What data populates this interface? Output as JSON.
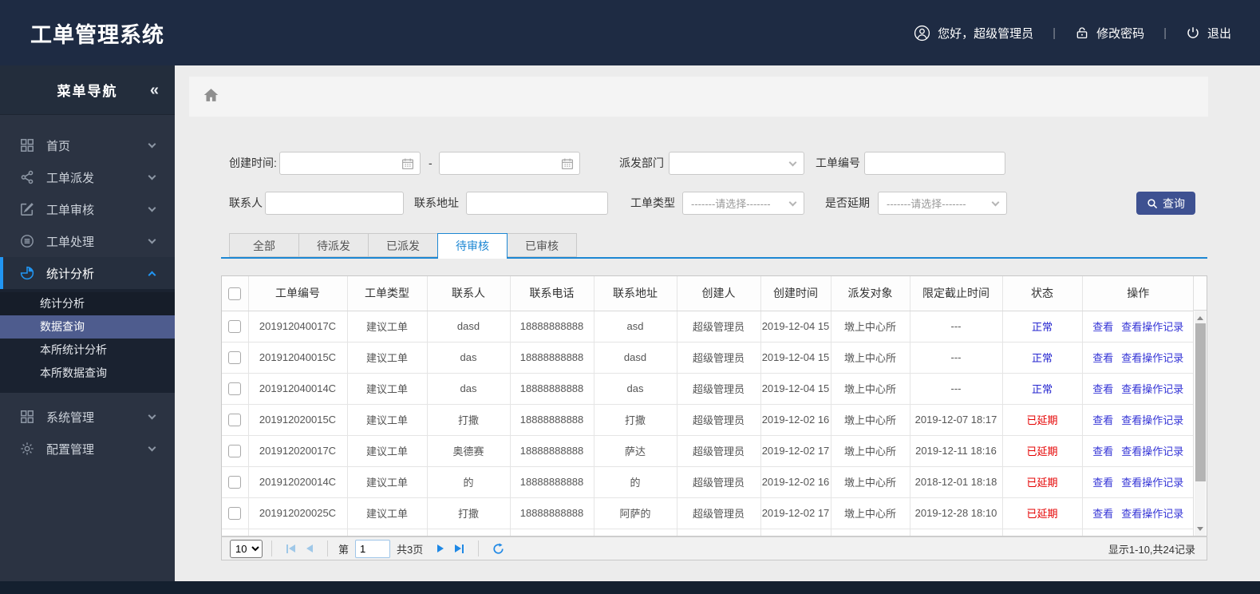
{
  "header": {
    "title": "工单管理系统",
    "greeting": "您好，超级管理员",
    "change_password": "修改密码",
    "logout": "退出",
    "separator": "|"
  },
  "sidebar": {
    "title": "菜单导航",
    "collapse_glyph": "«",
    "items": [
      {
        "label": "首页",
        "icon": "grid-icon"
      },
      {
        "label": "工单派发",
        "icon": "share-icon"
      },
      {
        "label": "工单审核",
        "icon": "edit-icon"
      },
      {
        "label": "工单处理",
        "icon": "process-icon"
      },
      {
        "label": "统计分析",
        "icon": "pie-chart-icon"
      },
      {
        "label": "系统管理",
        "icon": "grid-icon"
      },
      {
        "label": "配置管理",
        "icon": "gear-icon"
      }
    ],
    "submenu_items": [
      "统计分析",
      "数据查询",
      "本所统计分析",
      "本所数据查询"
    ],
    "selected_submenu": "数据查询"
  },
  "filters": {
    "create_time_label": "创建时间:",
    "range_dash": "-",
    "date_from_value": "",
    "date_to_value": "",
    "dispatch_dept_label": "派发部门",
    "dispatch_dept_value": "",
    "order_no_label": "工单编号",
    "order_no_value": "",
    "contact_label": "联系人",
    "contact_value": "",
    "address_label": "联系地址",
    "address_value": "",
    "order_type_label": "工单类型",
    "delay_label": "是否延期",
    "select_placeholder": "-------请选择-------",
    "search_button": "查询"
  },
  "tabs": [
    {
      "label": "全部"
    },
    {
      "label": "待派发"
    },
    {
      "label": "已派发"
    },
    {
      "label": "待审核",
      "active": true
    },
    {
      "label": "已审核"
    }
  ],
  "table": {
    "columns": [
      "工单编号",
      "工单类型",
      "联系人",
      "联系电话",
      "联系地址",
      "创建人",
      "创建时间",
      "派发对象",
      "限定截止时间",
      "状态",
      "操作"
    ],
    "actions": {
      "view": "查看",
      "view_log": "查看操作记录"
    },
    "rows": [
      {
        "no": "201912040017C",
        "type": "建议工单",
        "contact": "dasd",
        "phone": "18888888888",
        "addr": "asd",
        "creator": "超级管理员",
        "ctime": "2019-12-04 15",
        "target": "墩上中心所",
        "deadline": "---",
        "status": "正常"
      },
      {
        "no": "201912040015C",
        "type": "建议工单",
        "contact": "das",
        "phone": "18888888888",
        "addr": "dasd",
        "creator": "超级管理员",
        "ctime": "2019-12-04 15",
        "target": "墩上中心所",
        "deadline": "---",
        "status": "正常"
      },
      {
        "no": "201912040014C",
        "type": "建议工单",
        "contact": "das",
        "phone": "18888888888",
        "addr": "das",
        "creator": "超级管理员",
        "ctime": "2019-12-04 15",
        "target": "墩上中心所",
        "deadline": "---",
        "status": "正常"
      },
      {
        "no": "201912020015C",
        "type": "建议工单",
        "contact": "打撒",
        "phone": "18888888888",
        "addr": "打撒",
        "creator": "超级管理员",
        "ctime": "2019-12-02 16",
        "target": "墩上中心所",
        "deadline": "2019-12-07 18:17",
        "status": "已延期"
      },
      {
        "no": "201912020017C",
        "type": "建议工单",
        "contact": "奥德赛",
        "phone": "18888888888",
        "addr": "萨达",
        "creator": "超级管理员",
        "ctime": "2019-12-02 17",
        "target": "墩上中心所",
        "deadline": "2019-12-11 18:16",
        "status": "已延期"
      },
      {
        "no": "201912020014C",
        "type": "建议工单",
        "contact": "的",
        "phone": "18888888888",
        "addr": "的",
        "creator": "超级管理员",
        "ctime": "2019-12-02 16",
        "target": "墩上中心所",
        "deadline": "2018-12-01 18:18",
        "status": "已延期"
      },
      {
        "no": "201912020025C",
        "type": "建议工单",
        "contact": "打撒",
        "phone": "18888888888",
        "addr": "阿萨的",
        "creator": "超级管理员",
        "ctime": "2019-12-02 17",
        "target": "墩上中心所",
        "deadline": "2019-12-28 18:10",
        "status": "已延期"
      }
    ]
  },
  "pagination": {
    "page_size": "10",
    "page_prefix": "第",
    "page_value": "1",
    "page_total": "共3页",
    "summary": "显示1-10,共24记录"
  },
  "colors": {
    "header_bg": "#1e2b43",
    "sidebar_bg": "#2b3342",
    "accent_blue": "#1d87d3",
    "submenu_selected": "#4e5c8e",
    "search_button_bg": "#3e5191",
    "link_blue": "#3434d6",
    "status_normal": "#2323cf",
    "status_delayed": "#e50000"
  }
}
